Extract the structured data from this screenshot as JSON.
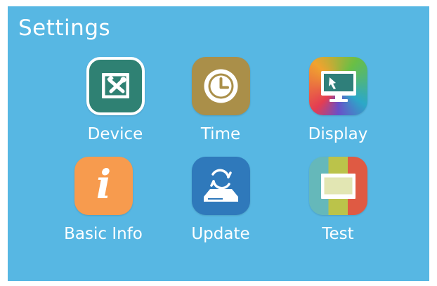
{
  "screen": {
    "title": "Settings",
    "background_color": "#57b7e3",
    "text_color": "#ffffff"
  },
  "apps": [
    {
      "label": "Device",
      "icon": "tools-icon",
      "color": "#2f8173"
    },
    {
      "label": "Time",
      "icon": "clock-icon",
      "color": "#aa8f49"
    },
    {
      "label": "Display",
      "icon": "monitor-cursor-icon",
      "colors": [
        "#e43d52",
        "#f0a32f",
        "#69bf45",
        "#2ca8c8",
        "#6a4fc8"
      ]
    },
    {
      "label": "Basic Info",
      "icon": "info-icon",
      "color": "#f79b4e",
      "symbol": "i"
    },
    {
      "label": "Update",
      "icon": "update-icon",
      "color": "#2f79bb"
    },
    {
      "label": "Test",
      "icon": "test-screen-icon",
      "colors": [
        "#65b8ba",
        "#bbc34a",
        "#df5a43"
      ]
    }
  ]
}
